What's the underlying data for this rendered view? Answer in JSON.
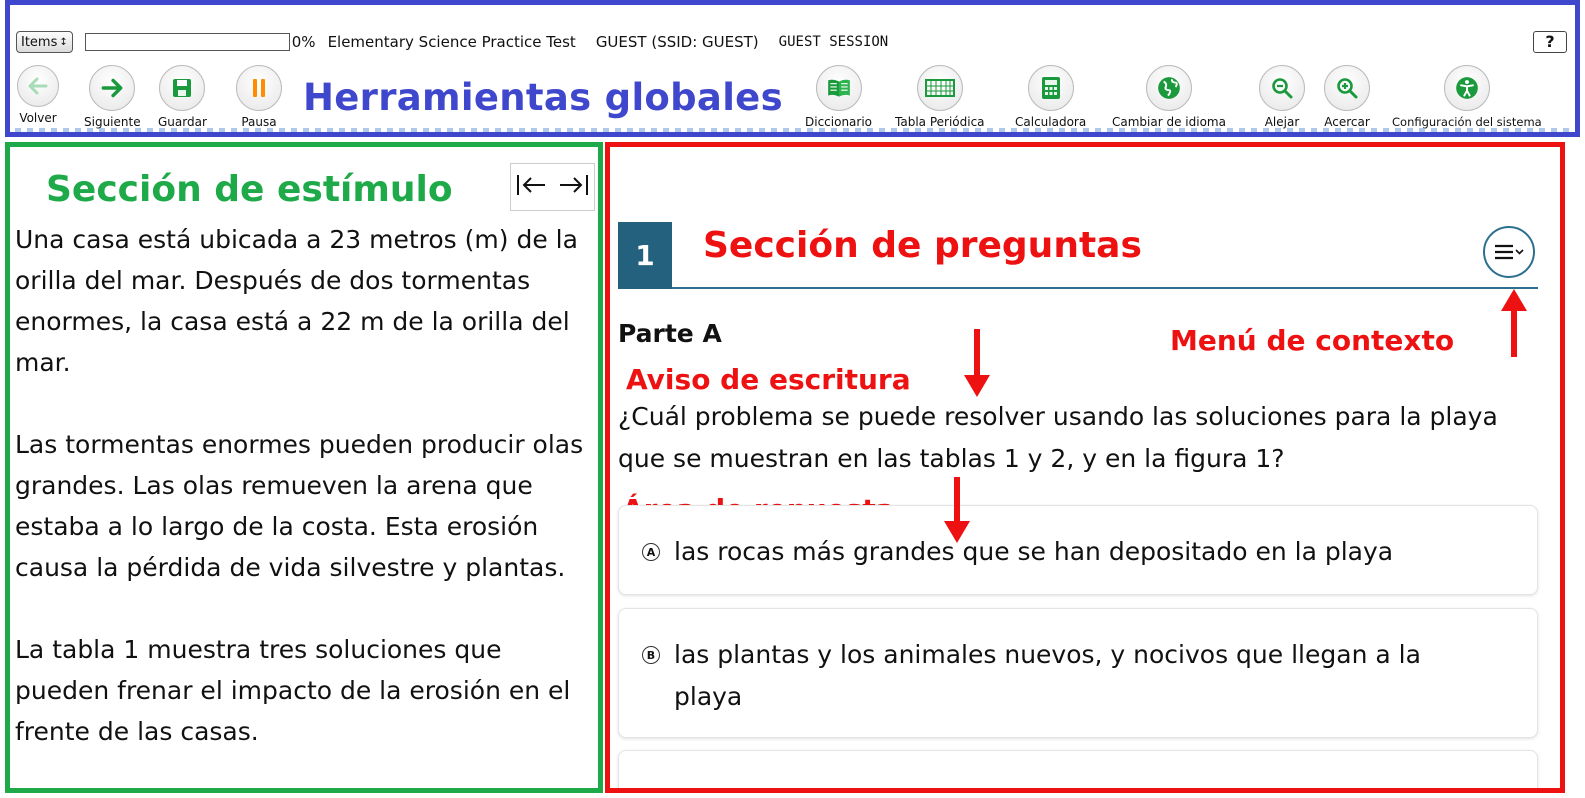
{
  "toolbar": {
    "items_label": "Items",
    "progress": 0,
    "progress_text": "0%",
    "test_name": "Elementary Science Practice Test",
    "guest_name": "GUEST (SSID: GUEST)",
    "session": "GUEST SESSION",
    "help_label": "?",
    "overlay_label": "Herramientas globales",
    "tools": {
      "back": "Volver",
      "next": "Siguiente",
      "save": "Guardar",
      "pause": "Pausa",
      "dictionary": "Diccionario",
      "periodic_table": "Tabla Periódica",
      "calculator": "Calculadora",
      "language": "Cambiar de idioma",
      "zoom_out": "Alejar",
      "zoom_in": "Acercar",
      "settings": "Configuración del sistema"
    },
    "colors": {
      "border": "#3f48cc",
      "next": "#1a9a3c",
      "pause": "#ff8c00"
    }
  },
  "stimulus": {
    "overlay_label": "Sección de estímulo",
    "paragraphs": [
      "Una casa está ubicada a 23 metros (m) de la orilla del mar. Después de dos tormentas enormes, la casa está a 22 m de la orilla del mar.",
      "Las tormentas enormes pueden producir olas grandes. Las olas remueven la arena que estaba a lo largo de la costa. Esta erosión causa la pérdida de vida silvestre y plantas.",
      "La tabla 1 muestra tres soluciones que pueden frenar el impacto de la erosión en el frente de las casas."
    ],
    "color": "#1faa4a"
  },
  "question": {
    "number": "1",
    "overlay_label": "Sección de preguntas",
    "part": "Parte A",
    "prompt": "¿Cuál problema se puede resolver usando las soluciones para la playa que se muestran en las tablas 1 y 2, y en la figura 1?",
    "annotations": {
      "context_menu": "Menú de contexto",
      "writing_prompt": "Aviso de escritura",
      "response_area": "Área de repuesta"
    },
    "options": [
      {
        "letter": "A",
        "text": "las rocas más grandes que se han depositado en la playa"
      },
      {
        "letter": "B",
        "text": "las plantas y los animales nuevos, y nocivos que llegan a la playa"
      }
    ],
    "color": "#ee1111",
    "header_color": "#24617e"
  }
}
